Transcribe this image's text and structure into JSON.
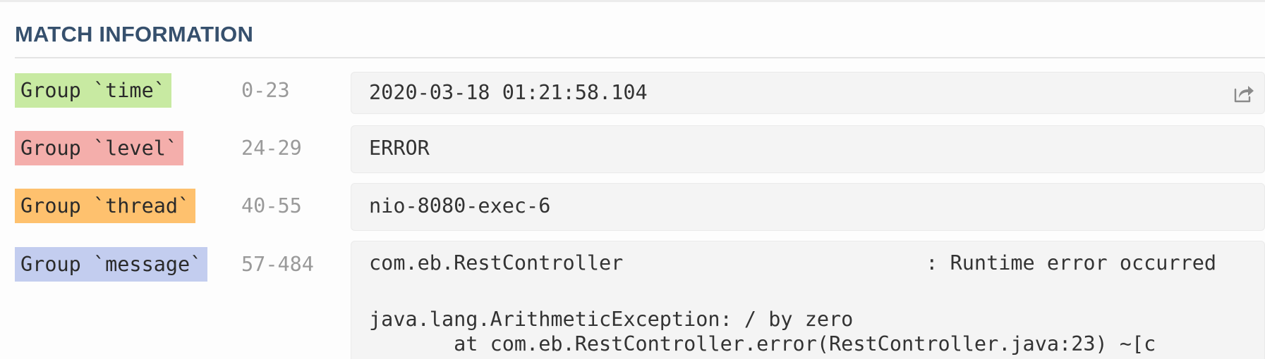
{
  "section": {
    "title": "MATCH INFORMATION"
  },
  "groups": [
    {
      "label": "Group `time`",
      "range": "0-23",
      "value": "2020-03-18 01:21:58.104",
      "color": "#c8eaa2"
    },
    {
      "label": "Group `level`",
      "range": "24-29",
      "value": "ERROR",
      "color": "#f4aeab"
    },
    {
      "label": "Group `thread`",
      "range": "40-55",
      "value": "nio-8080-exec-6",
      "color": "#fec16e"
    },
    {
      "label": "Group `message`",
      "range": "57-484",
      "value_lines": [
        "com.eb.RestController                         : Runtime error occurred",
        "",
        "java.lang.ArithmeticException: / by zero",
        "       at com.eb.RestController.error(RestController.java:23) ~[c"
      ],
      "color": "#c3cdef"
    }
  ],
  "icons": {
    "share": "share-icon"
  }
}
